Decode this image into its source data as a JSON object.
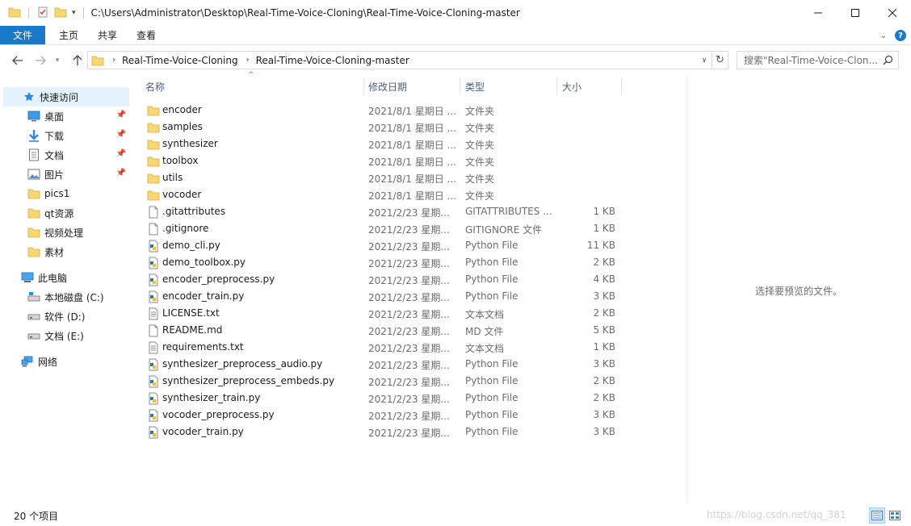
{
  "window": {
    "path": "C:\\Users\\Administrator\\Desktop\\Real-Time-Voice-Cloning\\Real-Time-Voice-Cloning-master"
  },
  "ribbon": {
    "tabs": [
      "文件",
      "主页",
      "共享",
      "查看"
    ]
  },
  "address": {
    "crumbs": [
      "Real-Time-Voice-Cloning",
      "Real-Time-Voice-Cloning-master"
    ]
  },
  "search": {
    "placeholder": "搜索\"Real-Time-Voice-Clon..."
  },
  "nav": {
    "quick_access": "快速访问",
    "items": [
      {
        "label": "桌面",
        "icon": "desktop-icon",
        "pinned": true
      },
      {
        "label": "下载",
        "icon": "download-icon",
        "pinned": true
      },
      {
        "label": "文档",
        "icon": "document-icon",
        "pinned": true
      },
      {
        "label": "图片",
        "icon": "picture-icon",
        "pinned": true
      },
      {
        "label": "pics1",
        "icon": "folder-icon",
        "pinned": false
      },
      {
        "label": "qt资源",
        "icon": "folder-icon",
        "pinned": false
      },
      {
        "label": "视频处理",
        "icon": "folder-icon",
        "pinned": false
      },
      {
        "label": "素材",
        "icon": "folder-icon",
        "pinned": false
      }
    ],
    "this_pc": "此电脑",
    "drives": [
      {
        "label": "本地磁盘 (C:)",
        "icon": "windows-drive-icon"
      },
      {
        "label": "软件 (D:)",
        "icon": "drive-icon"
      },
      {
        "label": "文档 (E:)",
        "icon": "drive-icon"
      }
    ],
    "network": "网络"
  },
  "columns": {
    "name": "名称",
    "date": "修改日期",
    "type": "类型",
    "size": "大小"
  },
  "files": [
    {
      "name": "encoder",
      "date": "2021/8/1 星期日 ...",
      "type": "文件夹",
      "size": "",
      "icon": "folder"
    },
    {
      "name": "samples",
      "date": "2021/8/1 星期日 ...",
      "type": "文件夹",
      "size": "",
      "icon": "folder"
    },
    {
      "name": "synthesizer",
      "date": "2021/8/1 星期日 ...",
      "type": "文件夹",
      "size": "",
      "icon": "folder"
    },
    {
      "name": "toolbox",
      "date": "2021/8/1 星期日 ...",
      "type": "文件夹",
      "size": "",
      "icon": "folder"
    },
    {
      "name": "utils",
      "date": "2021/8/1 星期日 ...",
      "type": "文件夹",
      "size": "",
      "icon": "folder"
    },
    {
      "name": "vocoder",
      "date": "2021/8/1 星期日 ...",
      "type": "文件夹",
      "size": "",
      "icon": "folder"
    },
    {
      "name": ".gitattributes",
      "date": "2021/2/23 星期...",
      "type": "GITATTRIBUTES ...",
      "size": "1 KB",
      "icon": "blank"
    },
    {
      "name": ".gitignore",
      "date": "2021/2/23 星期...",
      "type": "GITIGNORE 文件",
      "size": "1 KB",
      "icon": "blank"
    },
    {
      "name": "demo_cli.py",
      "date": "2021/2/23 星期...",
      "type": "Python File",
      "size": "11 KB",
      "icon": "python"
    },
    {
      "name": "demo_toolbox.py",
      "date": "2021/2/23 星期...",
      "type": "Python File",
      "size": "2 KB",
      "icon": "python"
    },
    {
      "name": "encoder_preprocess.py",
      "date": "2021/2/23 星期...",
      "type": "Python File",
      "size": "4 KB",
      "icon": "python"
    },
    {
      "name": "encoder_train.py",
      "date": "2021/2/23 星期...",
      "type": "Python File",
      "size": "3 KB",
      "icon": "python"
    },
    {
      "name": "LICENSE.txt",
      "date": "2021/2/23 星期...",
      "type": "文本文档",
      "size": "2 KB",
      "icon": "text"
    },
    {
      "name": "README.md",
      "date": "2021/2/23 星期...",
      "type": "MD 文件",
      "size": "5 KB",
      "icon": "blank"
    },
    {
      "name": "requirements.txt",
      "date": "2021/2/23 星期...",
      "type": "文本文档",
      "size": "1 KB",
      "icon": "text"
    },
    {
      "name": "synthesizer_preprocess_audio.py",
      "date": "2021/2/23 星期...",
      "type": "Python File",
      "size": "3 KB",
      "icon": "python"
    },
    {
      "name": "synthesizer_preprocess_embeds.py",
      "date": "2021/2/23 星期...",
      "type": "Python File",
      "size": "2 KB",
      "icon": "python"
    },
    {
      "name": "synthesizer_train.py",
      "date": "2021/2/23 星期...",
      "type": "Python File",
      "size": "2 KB",
      "icon": "python"
    },
    {
      "name": "vocoder_preprocess.py",
      "date": "2021/2/23 星期...",
      "type": "Python File",
      "size": "3 KB",
      "icon": "python"
    },
    {
      "name": "vocoder_train.py",
      "date": "2021/2/23 星期...",
      "type": "Python File",
      "size": "3 KB",
      "icon": "python"
    }
  ],
  "preview": {
    "message": "选择要预览的文件。"
  },
  "status": {
    "item_count": "20 个项目",
    "watermark": "https://blog.csdn.net/qq_381"
  },
  "colors": {
    "accent": "#1979ca",
    "folder": "#f8d775",
    "selection": "#e5f3ff"
  }
}
